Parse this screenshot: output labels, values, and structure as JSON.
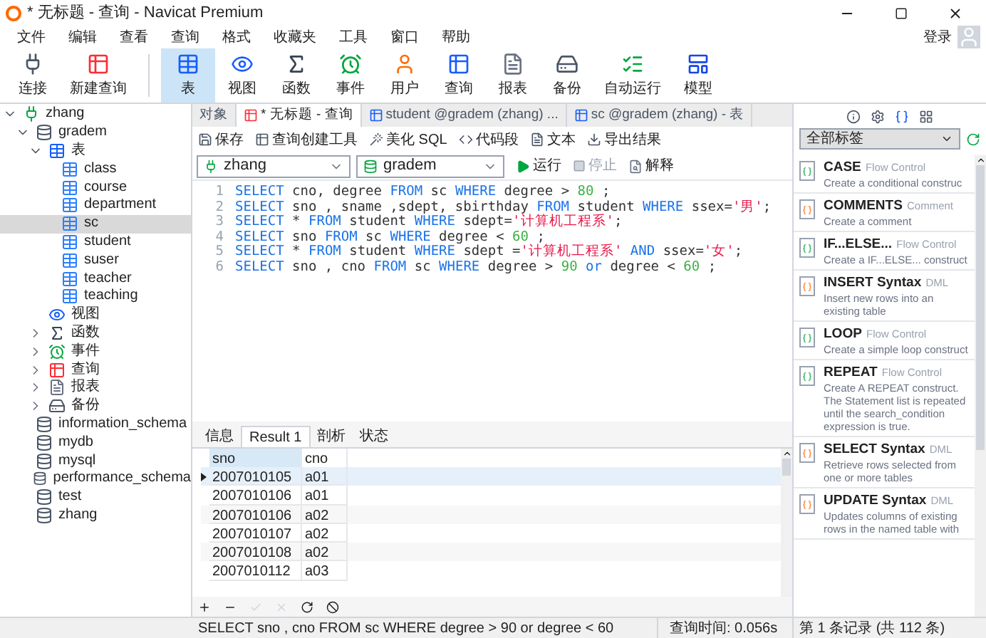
{
  "window": {
    "title": "* 无标题 - 查询 - Navicat Premium",
    "login": "登录"
  },
  "menu": [
    "文件",
    "编辑",
    "查看",
    "查询",
    "格式",
    "收藏夹",
    "工具",
    "窗口",
    "帮助"
  ],
  "toolbar": [
    {
      "label": "连接",
      "kind": "connect",
      "selected": false
    },
    {
      "label": "新建查询",
      "kind": "newquery",
      "selected": false
    },
    {
      "label": "表",
      "kind": "table",
      "selected": true
    },
    {
      "label": "视图",
      "kind": "view",
      "selected": false
    },
    {
      "label": "函数",
      "kind": "function",
      "selected": false
    },
    {
      "label": "事件",
      "kind": "event",
      "selected": false
    },
    {
      "label": "用户",
      "kind": "user",
      "selected": false
    },
    {
      "label": "查询",
      "kind": "query",
      "selected": false
    },
    {
      "label": "报表",
      "kind": "report",
      "selected": false
    },
    {
      "label": "备份",
      "kind": "backup",
      "selected": false
    },
    {
      "label": "自动运行",
      "kind": "auto",
      "selected": false
    },
    {
      "label": "模型",
      "kind": "model",
      "selected": false
    }
  ],
  "tree": [
    {
      "label": "zhang",
      "kind": "server",
      "expanded": true,
      "children": [
        {
          "label": "gradem",
          "kind": "database",
          "expanded": true,
          "children": [
            {
              "label": "表",
              "kind": "tables",
              "expanded": true,
              "children": [
                {
                  "label": "class",
                  "kind": "table",
                  "selected": false
                },
                {
                  "label": "course",
                  "kind": "table",
                  "selected": false
                },
                {
                  "label": "department",
                  "kind": "table",
                  "selected": false
                },
                {
                  "label": "sc",
                  "kind": "table",
                  "selected": true
                },
                {
                  "label": "student",
                  "kind": "table",
                  "selected": false
                },
                {
                  "label": "suser",
                  "kind": "table",
                  "selected": false
                },
                {
                  "label": "teacher",
                  "kind": "table",
                  "selected": false
                },
                {
                  "label": "teaching",
                  "kind": "table",
                  "selected": false
                }
              ]
            },
            {
              "label": "视图",
              "kind": "views"
            },
            {
              "label": "函数",
              "kind": "functions",
              "expanded": false
            },
            {
              "label": "事件",
              "kind": "events",
              "expanded": false
            },
            {
              "label": "查询",
              "kind": "queries",
              "expanded": false
            },
            {
              "label": "报表",
              "kind": "reports",
              "expanded": false
            },
            {
              "label": "备份",
              "kind": "backups",
              "expanded": false
            }
          ]
        },
        {
          "label": "information_schema",
          "kind": "database"
        },
        {
          "label": "mydb",
          "kind": "database"
        },
        {
          "label": "mysql",
          "kind": "database"
        },
        {
          "label": "performance_schema",
          "kind": "database"
        },
        {
          "label": "test",
          "kind": "database"
        },
        {
          "label": "zhang",
          "kind": "database"
        }
      ]
    }
  ],
  "tabs": [
    {
      "label": "对象",
      "kind": "objects",
      "selected": false
    },
    {
      "label": "* 无标题 - 查询",
      "kind": "query",
      "selected": true
    },
    {
      "label": "student @gradem (zhang) ...",
      "kind": "table",
      "selected": false
    },
    {
      "label": "sc @gradem (zhang) - 表",
      "kind": "table",
      "selected": false
    }
  ],
  "query_toolbar": [
    {
      "label": "保存",
      "kind": "save"
    },
    {
      "label": "查询创建工具",
      "kind": "builder"
    },
    {
      "label": "美化 SQL",
      "kind": "beautify"
    },
    {
      "label": "代码段",
      "kind": "snippet"
    },
    {
      "label": "文本",
      "kind": "text"
    },
    {
      "label": "导出结果",
      "kind": "export"
    }
  ],
  "connection": {
    "server": "zhang",
    "database": "gradem"
  },
  "run_buttons": [
    {
      "label": "运行",
      "kind": "run",
      "disabled": false
    },
    {
      "label": "停止",
      "kind": "stop",
      "disabled": true
    },
    {
      "label": "解释",
      "kind": "explain",
      "disabled": false
    }
  ],
  "editor": [
    {
      "number": "1",
      "tokens": [
        {
          "t": "SELECT",
          "kind": "kw"
        },
        {
          "t": " cno, degree ",
          "kind": "id"
        },
        {
          "t": "FROM",
          "kind": "kw"
        },
        {
          "t": " sc ",
          "kind": "id"
        },
        {
          "t": "WHERE",
          "kind": "kw"
        },
        {
          "t": " degree > ",
          "kind": "id"
        },
        {
          "t": "80",
          "kind": "num"
        },
        {
          "t": " ;",
          "kind": "id"
        }
      ]
    },
    {
      "number": "2",
      "tokens": [
        {
          "t": "SELECT",
          "kind": "kw"
        },
        {
          "t": " sno , sname ,sdept, sbirthday ",
          "kind": "id"
        },
        {
          "t": "FROM",
          "kind": "kw"
        },
        {
          "t": " student ",
          "kind": "id"
        },
        {
          "t": "WHERE",
          "kind": "kw"
        },
        {
          "t": " ssex=",
          "kind": "id"
        },
        {
          "t": "'男'",
          "kind": "str"
        },
        {
          "t": ";",
          "kind": "id"
        }
      ]
    },
    {
      "number": "3",
      "tokens": [
        {
          "t": "SELECT",
          "kind": "kw"
        },
        {
          "t": " * ",
          "kind": "id"
        },
        {
          "t": "FROM",
          "kind": "kw"
        },
        {
          "t": " student ",
          "kind": "id"
        },
        {
          "t": "WHERE",
          "kind": "kw"
        },
        {
          "t": " sdept=",
          "kind": "id"
        },
        {
          "t": "'计算机工程系'",
          "kind": "str"
        },
        {
          "t": ";",
          "kind": "id"
        }
      ]
    },
    {
      "number": "4",
      "tokens": [
        {
          "t": "SELECT",
          "kind": "kw"
        },
        {
          "t": " sno ",
          "kind": "id"
        },
        {
          "t": "FROM",
          "kind": "kw"
        },
        {
          "t": " sc ",
          "kind": "id"
        },
        {
          "t": "WHERE",
          "kind": "kw"
        },
        {
          "t": " degree < ",
          "kind": "id"
        },
        {
          "t": "60",
          "kind": "num"
        },
        {
          "t": " ;",
          "kind": "id"
        }
      ]
    },
    {
      "number": "5",
      "tokens": [
        {
          "t": "SELECT",
          "kind": "kw"
        },
        {
          "t": " * ",
          "kind": "id"
        },
        {
          "t": "FROM",
          "kind": "kw"
        },
        {
          "t": " student ",
          "kind": "id"
        },
        {
          "t": "WHERE",
          "kind": "kw"
        },
        {
          "t": " sdept =",
          "kind": "id"
        },
        {
          "t": "'计算机工程系' ",
          "kind": "str"
        },
        {
          "t": "AND",
          "kind": "kw"
        },
        {
          "t": " ssex=",
          "kind": "id"
        },
        {
          "t": "'女'",
          "kind": "str"
        },
        {
          "t": ";",
          "kind": "id"
        }
      ]
    },
    {
      "number": "6",
      "tokens": [
        {
          "t": "SELECT",
          "kind": "kw"
        },
        {
          "t": " sno , cno ",
          "kind": "id"
        },
        {
          "t": "FROM",
          "kind": "kw"
        },
        {
          "t": " sc ",
          "kind": "id"
        },
        {
          "t": "WHERE",
          "kind": "kw"
        },
        {
          "t": " degree > ",
          "kind": "id"
        },
        {
          "t": "90 ",
          "kind": "num"
        },
        {
          "t": "or",
          "kind": "kw"
        },
        {
          "t": " degree < ",
          "kind": "id"
        },
        {
          "t": "60",
          "kind": "num"
        },
        {
          "t": " ;",
          "kind": "id"
        }
      ]
    }
  ],
  "result_tabs": [
    {
      "label": "信息",
      "selected": false
    },
    {
      "label": "Result 1",
      "selected": true
    },
    {
      "label": "剖析",
      "selected": false
    },
    {
      "label": "状态",
      "selected": false
    }
  ],
  "result": {
    "columns": [
      "sno",
      "cno"
    ],
    "rows": [
      {
        "cells": [
          "2007010105",
          "a01"
        ],
        "selected": true
      },
      {
        "cells": [
          "2007010106",
          "a01"
        ],
        "selected": false
      },
      {
        "cells": [
          "2007010106",
          "a02"
        ],
        "selected": false
      },
      {
        "cells": [
          "2007010107",
          "a02"
        ],
        "selected": false
      },
      {
        "cells": [
          "2007010108",
          "a02"
        ],
        "selected": false
      },
      {
        "cells": [
          "2007010112",
          "a03"
        ],
        "selected": false
      }
    ]
  },
  "snippets": {
    "filter": "全部标签",
    "items": [
      {
        "title": "CASE",
        "category": "Flow Control",
        "description": "Create a conditional construc",
        "kind": "flow"
      },
      {
        "title": "COMMENTS",
        "category": "Comment",
        "description": "Create a comment",
        "kind": "syntax"
      },
      {
        "title": "IF...ELSE...",
        "category": "Flow Control",
        "description": "Create a IF...ELSE... construct",
        "kind": "flow"
      },
      {
        "title": "INSERT Syntax",
        "category": "DML",
        "description": "Insert new rows into an existing table",
        "kind": "syntax"
      },
      {
        "title": "LOOP",
        "category": "Flow Control",
        "description": "Create a simple loop construct",
        "kind": "flow"
      },
      {
        "title": "REPEAT",
        "category": "Flow Control",
        "description": "Create A REPEAT construct. The Statement list is repeated until the search_condition expression is true.",
        "kind": "flow"
      },
      {
        "title": "SELECT Syntax",
        "category": "DML",
        "description": "Retrieve rows selected from one or more tables",
        "kind": "syntax"
      },
      {
        "title": "UPDATE Syntax",
        "category": "DML",
        "description": "Updates columns of existing rows in the named table with",
        "kind": "syntax"
      }
    ]
  },
  "status_bar": {
    "sql": "SELECT sno , cno FROM sc WHERE degree > 90 or degree < 60",
    "time": "查询时间: 0.056s",
    "records": "第 1 条记录 (共 112 条)"
  }
}
